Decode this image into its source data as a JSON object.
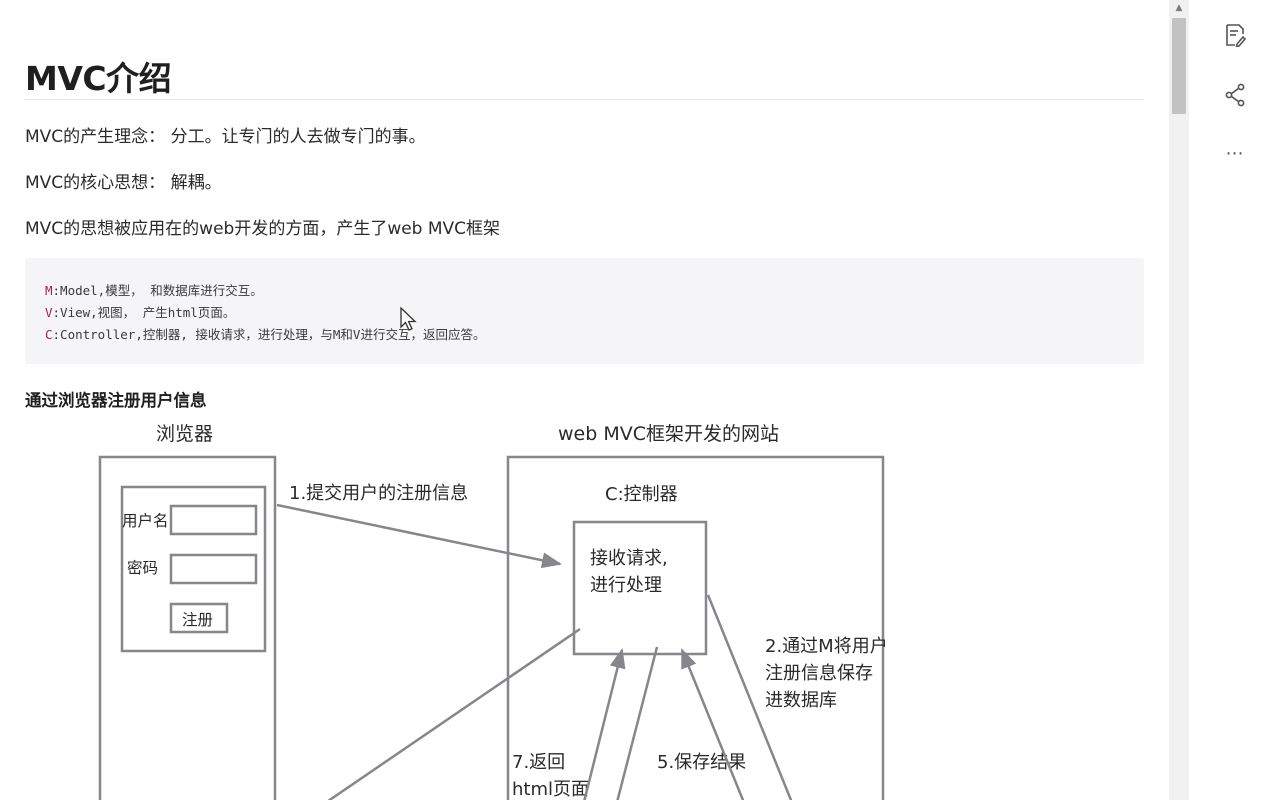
{
  "article": {
    "title": "MVC介绍",
    "paragraphs": [
      "MVC的产生理念： 分工。让专门的人去做专门的事。",
      "MVC的核心思想： 解耦。",
      "MVC的思想被应用在的web开发的方面，产生了web MVC框架"
    ],
    "code_lines": [
      {
        "key": "M",
        "rest": ":Model,模型， 和数据库进行交互。"
      },
      {
        "key": "V",
        "rest": ":View,视图， 产生html页面。"
      },
      {
        "key": "C",
        "rest": ":Controller,控制器, 接收请求，进行处理，与M和V进行交互，返回应答。"
      }
    ],
    "subheading": "通过浏览器注册用户信息"
  },
  "diagram": {
    "browser_title": "浏览器",
    "site_title": "web MVC框架开发的网站",
    "username_label": "用户名",
    "password_label": "密码",
    "register_button": "注册",
    "step1": "1.提交用户的注册信息",
    "controller_label": "C:控制器",
    "controller_box_line1": "接收请求,",
    "controller_box_line2": "进行处理",
    "step2_line1": "2.通过M将用户",
    "step2_line2": "注册信息保存",
    "step2_line3": "进数据库",
    "step7_line1": "7.返回",
    "step7_line2": "html页面",
    "step5": "5.保存结果"
  },
  "rail": {
    "icons": [
      "edit-note-icon",
      "share-icon",
      "more-icon"
    ],
    "more_glyph": "⋯"
  },
  "scrollbar": {
    "up_glyph": "▲"
  }
}
